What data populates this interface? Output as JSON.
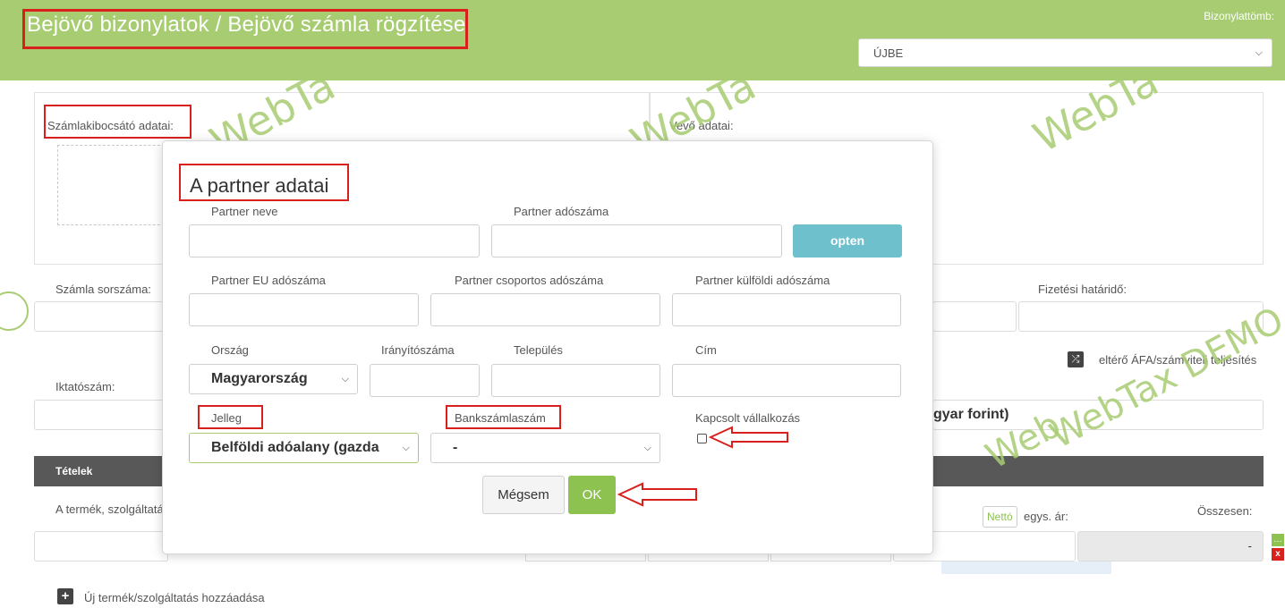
{
  "header": {
    "title": "Bejövő bizonylatok / Bejövő számla rögzítése",
    "block_label": "Bizonylattömb:",
    "block_value": "ÚJBE"
  },
  "form": {
    "issuer_label": "Számlakibocsátó adatai:",
    "buyer_label": "Vevő adatai:",
    "invoice_number_label": "Számla sorszáma:",
    "payment_due_label": "Fizetési határidő:",
    "filing_number_label": "Iktatószám:",
    "diff_vat_label": "eltérő ÁFA/számviteli teljesítés",
    "currency_value_partial": "gyar forint)",
    "items_header": "Tételek",
    "product_col_partial": "A termék, szolgáltatá",
    "net_toggle": "Nettó",
    "unit_price_label": "egys. ár:",
    "total_label": "Összesen:",
    "total_value": "-",
    "add_item_label": "Új termék/szolgáltatás hozzáadása"
  },
  "watermarks": [
    "WebTa",
    "WebTa",
    "WebTa",
    "WebTax DEMO",
    "Web"
  ],
  "modal": {
    "title": "A partner adatai",
    "partner_name_label": "Partner neve",
    "partner_taxnum_label": "Partner adószáma",
    "opten_button": "opten",
    "eu_taxnum_label": "Partner EU adószáma",
    "group_taxnum_label": "Partner csoportos adószáma",
    "foreign_taxnum_label": "Partner külföldi adószáma",
    "country_label": "Ország",
    "zip_label": "Irányítószáma",
    "city_label": "Település",
    "address_label": "Cím",
    "country_value": "Magyarország",
    "type_label": "Jelleg",
    "type_value": "Belföldi adóalany (gazda",
    "bank_label": "Bankszámlaszám",
    "bank_value": "-",
    "related_label": "Kapcsolt vállalkozás",
    "cancel_button": "Mégsem",
    "ok_button": "OK"
  },
  "colors": {
    "header_green": "#a7cc71",
    "annotation_red": "#d8211d",
    "opten_blue": "#6ec0cc",
    "ok_green": "#8dc150",
    "items_bar": "#585858"
  }
}
